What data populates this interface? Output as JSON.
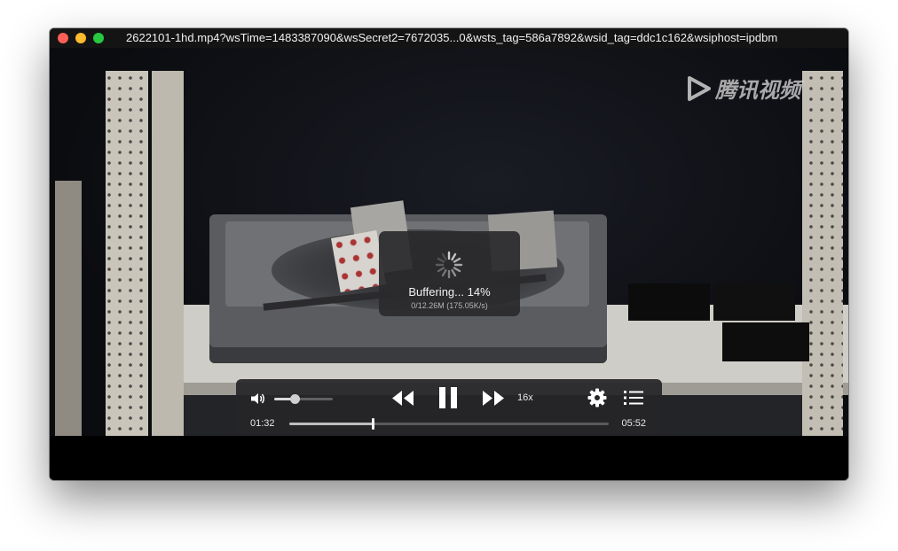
{
  "window": {
    "title": "2622101-1hd.mp4?wsTime=1483387090&wsSecret2=7672035...0&wsts_tag=586a7892&wsid_tag=ddc1c162&wsiphost=ipdbm"
  },
  "watermark": {
    "text": "腾讯视频",
    "icon": "play-logo-icon"
  },
  "buffering": {
    "label": "Buffering... 14%",
    "progress_percent": 14,
    "detail": "0/12.26M (175.05K/s)"
  },
  "controls": {
    "volume_level": 0.35,
    "speed": "16x",
    "current_time": "01:32",
    "total_time": "05:52",
    "playback_fraction": 0.26,
    "icons": {
      "volume": "speaker-icon",
      "rewind": "rewind-icon",
      "pause": "pause-icon",
      "fast_forward": "fast-forward-icon",
      "settings": "gear-icon",
      "playlist": "list-icon"
    }
  },
  "colors": {
    "close": "#ff5f57",
    "minimize": "#febc2e",
    "maximize": "#28c840",
    "panel": "#2a2a2c"
  }
}
